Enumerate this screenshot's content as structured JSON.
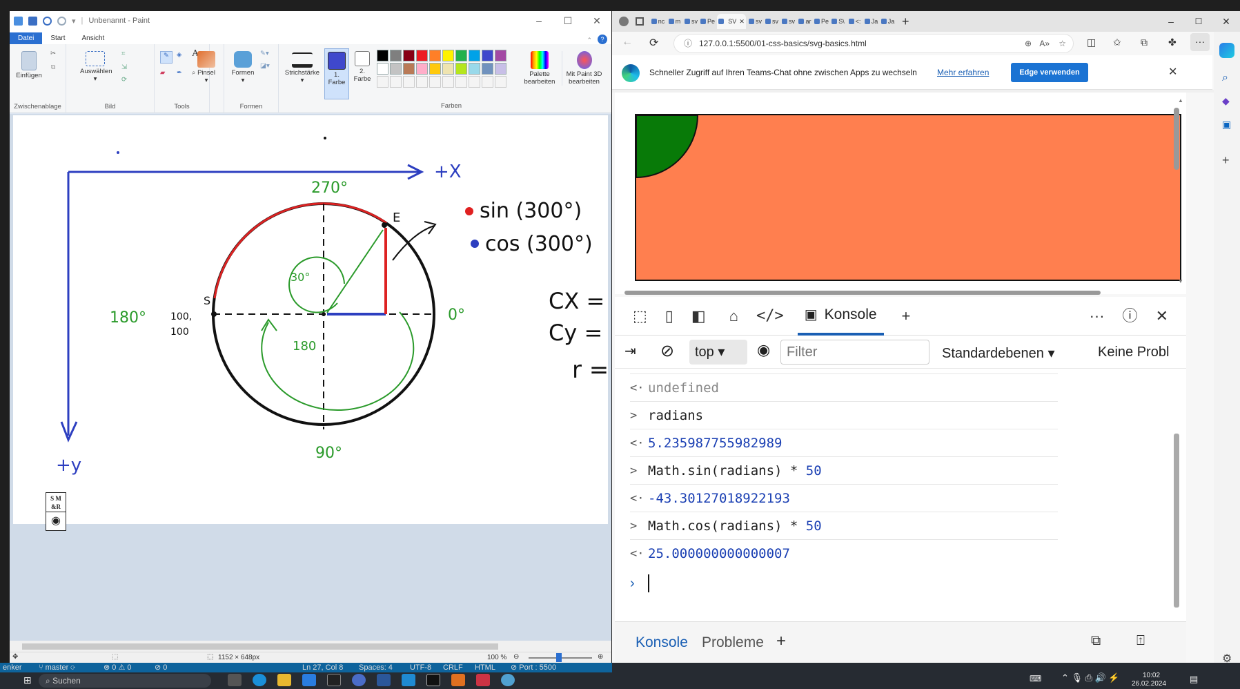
{
  "paint": {
    "title": "Unbenannt - Paint",
    "tabs": [
      "Datei",
      "Start",
      "Ansicht"
    ],
    "groups": {
      "clipboard": {
        "label": "Zwischenablage",
        "paste": "Einfügen"
      },
      "image": {
        "label": "Bild",
        "select": "Auswählen"
      },
      "tools": {
        "label": "Tools"
      },
      "brushes": {
        "label": "Pinsel"
      },
      "shapes": {
        "label": "Formen",
        "button": "Formen"
      },
      "stroke": {
        "label": "Strichstärke"
      },
      "color1": "1. Farbe",
      "color2": "2. Farbe",
      "colors": {
        "label": "Farben"
      },
      "palette": "Palette bearbeiten",
      "paint3d": "Mit Paint 3D bearbeiten"
    },
    "palette_colors": [
      "#000000",
      "#7f7f7f",
      "#880015",
      "#ed1c24",
      "#ff7f27",
      "#fff200",
      "#22b14c",
      "#00a2e8",
      "#3f48cc",
      "#a349a4",
      "#ffffff",
      "#c3c3c3",
      "#b97a57",
      "#ffaec9",
      "#ffc90e",
      "#efe4b0",
      "#b5e61d",
      "#99d9ea",
      "#7092be",
      "#c8bfe7"
    ],
    "primary_color": "#3f48cc",
    "canvas": {
      "axis_x_label": "+X",
      "axis_y_label": "+y",
      "angle_270": "270°",
      "angle_0": "0°",
      "angle_180": "180°",
      "angle_90": "90°",
      "angle_30": "30°",
      "inner_180": "180",
      "center_top": "100,",
      "center_bottom": "100",
      "point_s": "S",
      "point_e": "E",
      "legend_sin": "sin (300°)",
      "legend_cos": "cos (300°)",
      "cx": "CX =",
      "cy": "Cy =",
      "r": "r ="
    },
    "status": {
      "size": "1152 × 648px",
      "zoom": "100 %"
    }
  },
  "edge": {
    "tabs": [
      "nc",
      "m",
      "sv",
      "Pe",
      "SV",
      "sv",
      "sv",
      "sv",
      "ar",
      "Pe",
      "S\\",
      "<:",
      "Ja",
      "Ja"
    ],
    "url": "127.0.0.1:5500/01-css-basics/svg-basics.html",
    "banner": {
      "text": "Schneller Zugriff auf Ihren Teams-Chat ohne zwischen Apps zu wechseln",
      "link": "Mehr erfahren",
      "button": "Edge verwenden"
    },
    "devtools": {
      "tab_console": "Konsole",
      "context": "top",
      "filter_placeholder": "Filter",
      "levels": "Standardebenen",
      "issues": "Keine Probl",
      "lines": [
        {
          "type": "out",
          "text": "undefined"
        },
        {
          "type": "in",
          "text": "radians"
        },
        {
          "type": "out",
          "text": "5.235987755982989"
        },
        {
          "type": "in",
          "text": "Math.sin(radians) * 50",
          "num": "50"
        },
        {
          "type": "out",
          "text": "-43.30127018922193"
        },
        {
          "type": "in",
          "text": "Math.cos(radians) * 50",
          "num": "50"
        },
        {
          "type": "out",
          "text": "25.000000000000007"
        }
      ],
      "drawer_tabs": [
        "Konsole",
        "Probleme"
      ]
    }
  },
  "vscode": {
    "branch": "master",
    "problems": "0 ⚠ 0",
    "ports": "0",
    "position": "Ln 27, Col 8",
    "spaces": "Spaces: 4",
    "encoding": "UTF-8",
    "eol": "CRLF",
    "lang": "HTML",
    "port": "Port : 5500"
  },
  "taskbar": {
    "search": "Suchen",
    "time": "10:02",
    "date": "26.02.2024",
    "left_text": "enker"
  }
}
